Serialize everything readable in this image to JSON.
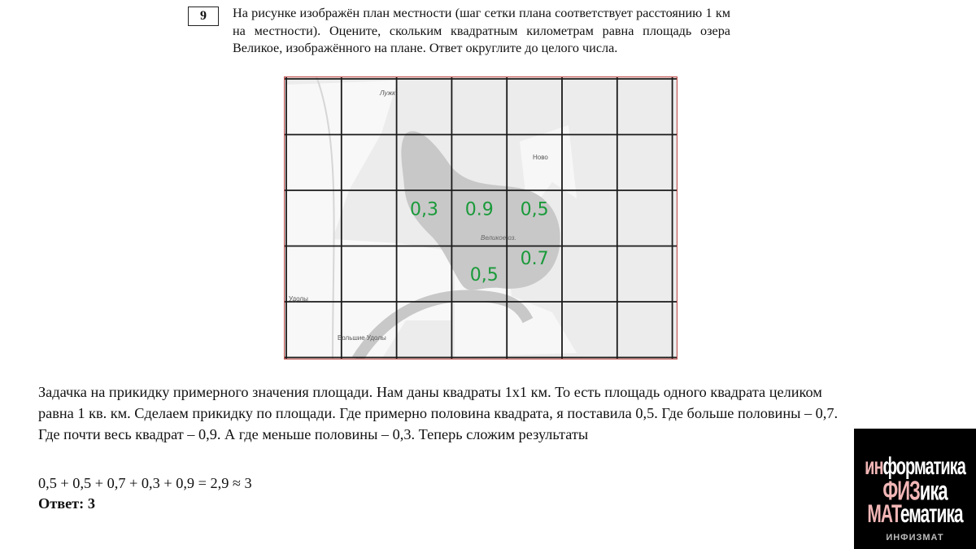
{
  "task": {
    "number": "9",
    "text": "На рисунке изображён план местности (шаг сетки плана соответствует расстоянию 1 км на местности). Оцените, скольким квадратным километрам равна площадь озера Великое, изображённого на плане. Ответ округлите до целого числа."
  },
  "map": {
    "grid_columns": 7,
    "grid_rows": 5,
    "grid_step_km": 1,
    "labels": {
      "luzh": "Лужк",
      "novo": "Ново",
      "lake": "Великое оз.",
      "udoly": "Удолы",
      "bolshie_udoly": "Большие Удолы"
    },
    "annotations": [
      {
        "text": "0,3",
        "col": 2,
        "row": 2
      },
      {
        "text": "0.9",
        "col": 3,
        "row": 2
      },
      {
        "text": "0,5",
        "col": 4,
        "row": 2
      },
      {
        "text": "0.7",
        "col": 4,
        "row": 3
      },
      {
        "text": "0,5",
        "col": 3,
        "row": 3
      }
    ],
    "colors": {
      "annotation": "#1a9a3a",
      "lake": "#cfcfcf",
      "land": "#e6e6e6",
      "grid": "#1a1a1a",
      "frame": "#c0504d"
    }
  },
  "solution": {
    "paragraph": "Задачка на прикидку примерного значения площади. Нам даны квадраты 1х1 км. То есть площадь одного квадрата целиком равна 1 кв. км. Сделаем прикидку по площади. Где примерно половина квадрата, я поставила 0,5. Где больше половины – 0,7. Где почти весь квадрат – 0,9. А где меньше половины – 0,3. Теперь сложим результаты",
    "formula": "0,5 + 0,5 + 0,7 + 0,3 + 0,9 = 2,9 ≈ 3",
    "answer": "Ответ: 3"
  },
  "logo": {
    "line1_a": "ин",
    "line1_b": "форматика",
    "line2_a": "ФИЗ",
    "line2_b": "ика",
    "line3_a": "МАТ",
    "line3_b": "ематика",
    "footer": "ИНФИЗМАТ"
  }
}
